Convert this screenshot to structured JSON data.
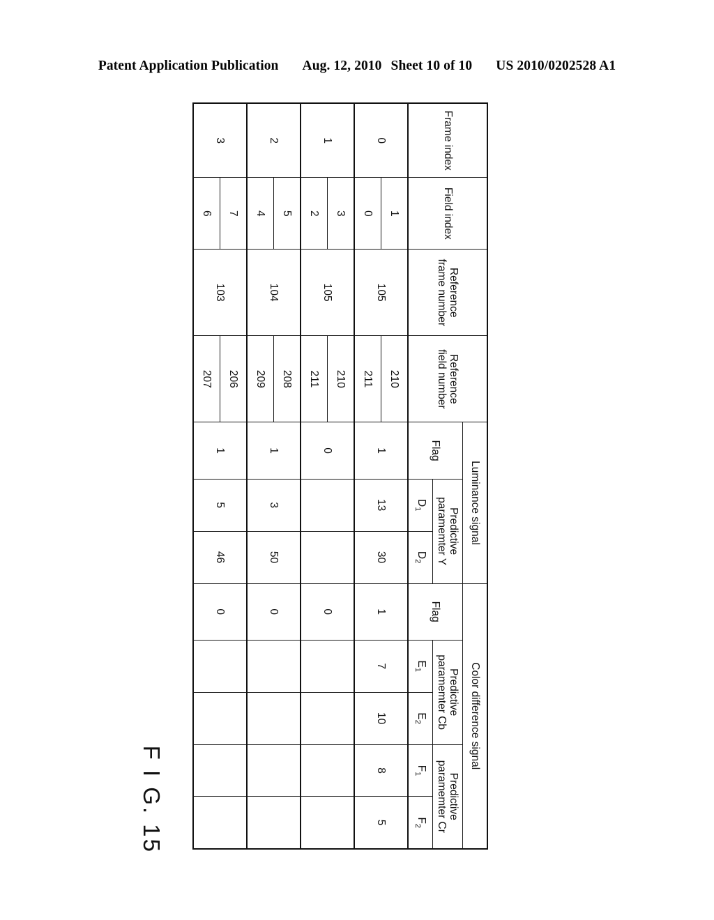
{
  "header": {
    "publication": "Patent Application Publication",
    "date": "Aug. 12, 2010",
    "sheet": "Sheet 10 of 10",
    "doc_number": "US 2010/0202528 A1"
  },
  "figure": {
    "caption": "F I G. 15"
  },
  "table": {
    "headers": {
      "frame_index": "Frame index",
      "field_index": "Field index",
      "reference_frame_number_l1": "Reference",
      "reference_frame_number_l2": "frame number",
      "reference_field_number_l1": "Reference",
      "reference_field_number_l2": "field number",
      "luminance_signal": "Luminance signal",
      "color_difference_signal": "Color difference signal",
      "flag": "Flag",
      "predictive_l1": "Predictive",
      "predictive_y_l2": "paramemter Y",
      "predictive_cb_l2": "paramemter Cb",
      "predictive_cr_l2": "paramemter Cr",
      "d1": "D",
      "d1_sub": "1",
      "d2": "D",
      "d2_sub": "2",
      "e1": "E",
      "e1_sub": "1",
      "e2": "E",
      "e2_sub": "2",
      "f1": "F",
      "f1_sub": "1",
      "f2": "F",
      "f2_sub": "2"
    },
    "rows": [
      {
        "frame_index": "0",
        "field_index": [
          "1",
          "0"
        ],
        "reference_frame_number": "105",
        "reference_field_number": [
          "210",
          "211"
        ],
        "luma_flag": "1",
        "luma_d1": "13",
        "luma_d2": "30",
        "chroma_flag": "1",
        "chroma_e1": "7",
        "chroma_e2": "10",
        "chroma_f1": "8",
        "chroma_f2": "5"
      },
      {
        "frame_index": "1",
        "field_index": [
          "3",
          "2"
        ],
        "reference_frame_number": "105",
        "reference_field_number": [
          "210",
          "211"
        ],
        "luma_flag": "0",
        "luma_d1": "",
        "luma_d2": "",
        "chroma_flag": "0",
        "chroma_e1": "",
        "chroma_e2": "",
        "chroma_f1": "",
        "chroma_f2": ""
      },
      {
        "frame_index": "2",
        "field_index": [
          "5",
          "4"
        ],
        "reference_frame_number": "104",
        "reference_field_number": [
          "208",
          "209"
        ],
        "luma_flag": "1",
        "luma_d1": "3",
        "luma_d2": "50",
        "chroma_flag": "0",
        "chroma_e1": "",
        "chroma_e2": "",
        "chroma_f1": "",
        "chroma_f2": ""
      },
      {
        "frame_index": "3",
        "field_index": [
          "7",
          "6"
        ],
        "reference_frame_number": "103",
        "reference_field_number": [
          "206",
          "207"
        ],
        "luma_flag": "1",
        "luma_d1": "5",
        "luma_d2": "46",
        "chroma_flag": "0",
        "chroma_e1": "",
        "chroma_e2": "",
        "chroma_f1": "",
        "chroma_f2": ""
      }
    ]
  }
}
